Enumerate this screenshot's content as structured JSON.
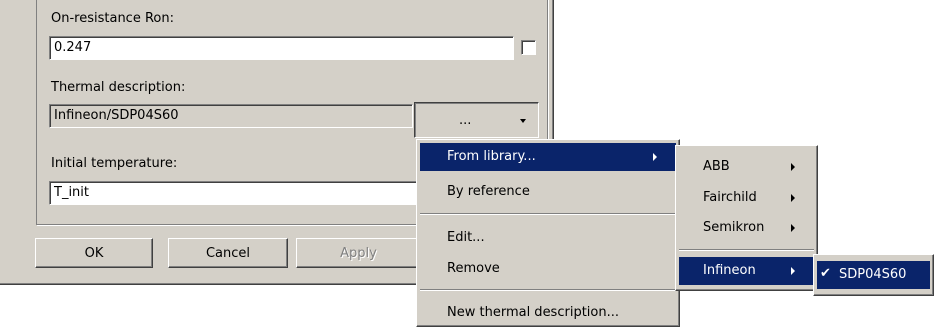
{
  "form": {
    "on_resistance_label": "On-resistance Ron:",
    "on_resistance_value": "0.247",
    "thermal_label": "Thermal description:",
    "thermal_value": "Infineon/SDP04S60",
    "thermal_button": "...",
    "initial_temp_label": "Initial temperature:",
    "initial_temp_value": "T_init"
  },
  "buttons": {
    "ok": "OK",
    "cancel": "Cancel",
    "apply": "Apply"
  },
  "context_menu": {
    "from_library": "From library...",
    "by_reference": "By reference",
    "edit": "Edit...",
    "remove": "Remove",
    "new_thermal": "New thermal description..."
  },
  "library_menu": {
    "abb": "ABB",
    "fairchild": "Fairchild",
    "semikron": "Semikron",
    "infineon": "Infineon"
  },
  "infineon_menu": {
    "check": "✔",
    "item": "SDP04S60"
  },
  "colors": {
    "dialog_bg": "#d4d0c8",
    "highlight": "#0a246a"
  }
}
